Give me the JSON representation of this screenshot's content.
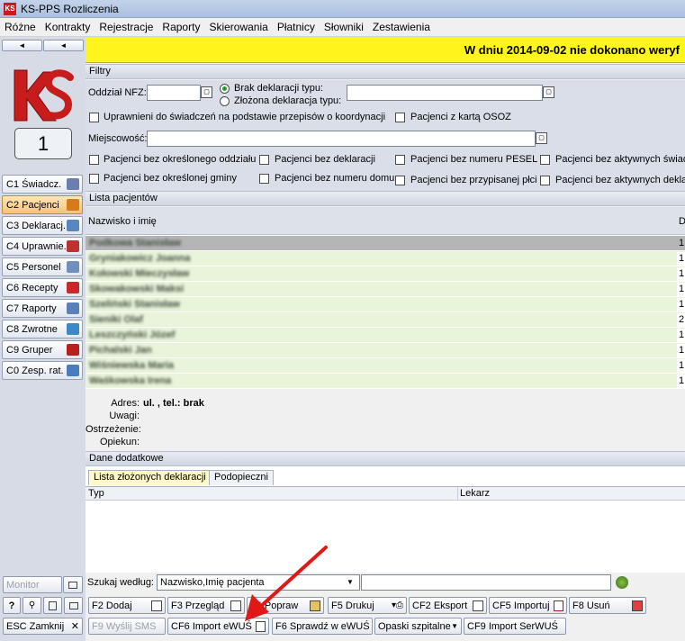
{
  "window": {
    "title": "KS-PPS Rozliczenia"
  },
  "menu": [
    "Różne",
    "Kontrakty",
    "Rejestracje",
    "Raporty",
    "Skierowania",
    "Płatnicy",
    "Słowniki",
    "Zestawienia"
  ],
  "left": {
    "nav_left": "◄",
    "nav_right": "◄",
    "counter": "1",
    "modules": [
      {
        "label": "C1 Świadcz.",
        "icon_color": "#6a7fb0"
      },
      {
        "label": "C2 Pacjenci",
        "icon_color": "#d87a1a"
      },
      {
        "label": "C3 Deklaracj.",
        "icon_color": "#5a86c0"
      },
      {
        "label": "C4 Uprawnie.",
        "icon_color": "#c03030"
      },
      {
        "label": "C5 Personel",
        "icon_color": "#6f8fbf"
      },
      {
        "label": "C6 Recepty",
        "icon_color": "#c82a2a"
      },
      {
        "label": "C7 Raporty",
        "icon_color": "#5a80b8"
      },
      {
        "label": "C8 Zwrotne",
        "icon_color": "#3c88c8"
      },
      {
        "label": "C9 Gruper",
        "icon_color": "#b82020"
      },
      {
        "label": "C0 Zesp. rat.",
        "icon_color": "#4a7cc0"
      }
    ],
    "monitor": "Monitor",
    "small_btn": "?",
    "esc": "ESC Zamknij"
  },
  "banner": {
    "text": "W dniu 2014-09-02 nie dokonano weryf"
  },
  "filtry": {
    "title": "Filtry",
    "oddzial_label": "Oddział NFZ:",
    "radio1": "Brak deklaracji typu:",
    "radio2": "Złożona deklaracja typu:",
    "chk_uprawnieni": "Uprawnieni do świadczeń na podstawie przepisów o koordynacji",
    "chk_osoz": "Pacjenci z kartą OSOZ",
    "miejscowosc_label": "Miejscowość:",
    "checks_row1": [
      "Pacjenci bez określonego oddziału",
      "Pacjenci bez deklaracji",
      "Pacjenci bez numeru PESEL",
      "Pacjenci bez aktywnych świad"
    ],
    "checks_row2": [
      "Pacjenci bez określonej gminy",
      "Pacjenci bez numeru domu",
      "Pacjenci bez przypisanej płci",
      "Pacjenci bez aktywnych dekla"
    ]
  },
  "lista": {
    "title": "Lista pacjentów",
    "col_name": "Nazwisko i imię",
    "col_right": "D",
    "rows": [
      {
        "name": "Podkowa Stanisław",
        "d": "1"
      },
      {
        "name": "Gryniakowicz Joanna",
        "d": "1"
      },
      {
        "name": "Kołowski Mieczysław",
        "d": "1"
      },
      {
        "name": "Skowakowski Maksi",
        "d": "1"
      },
      {
        "name": "Szeliński Stanisław",
        "d": "1"
      },
      {
        "name": "Sieniki Olaf",
        "d": "2"
      },
      {
        "name": "Leszczyński Józef",
        "d": "1"
      },
      {
        "name": "Pichalski Jan",
        "d": "1"
      },
      {
        "name": "Wiśniewska Maria",
        "d": "1"
      },
      {
        "name": "Waśkowska Irena",
        "d": "1"
      }
    ]
  },
  "details": {
    "adres_label": "Adres:",
    "adres_value": "ul. , tel.: brak",
    "uwagi_label": "Uwagi:",
    "ostrzezenie_label": "Ostrzeżenie:",
    "opiekun_label": "Opiekun:"
  },
  "dodatkowe": {
    "title": "Dane dodatkowe",
    "tab1": "Lista złożonych deklaracji",
    "tab2": "Podopieczni",
    "col_typ": "Typ",
    "col_lekarz": "Lekarz"
  },
  "szukaj": {
    "label": "Szukaj według:",
    "value": "Nazwisko,Imię pacjenta"
  },
  "buttons_row1": [
    "F2 Dodaj",
    "F3 Przegląd",
    "F4 Popraw",
    "F5 Drukuj",
    "CF2 Eksport",
    "CF5 Importuj",
    "F8 Usuń"
  ],
  "buttons_row2": [
    "F9 Wyślij SMS",
    "CF6 Import eWUŚ",
    "F6 Sprawdź w eWUŚ",
    "Opaski szpitalne",
    "CF9 Import SerWUŚ"
  ],
  "colors": {
    "banner": "#fdf51c",
    "row_bg": "#e9f5db",
    "selected_row": "#b5b5b5",
    "arrow": "#e01818",
    "active_module": "#f4c47a"
  }
}
